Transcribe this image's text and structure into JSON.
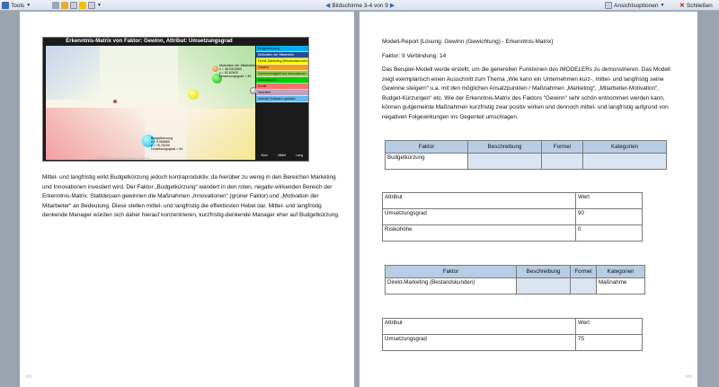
{
  "toolbar": {
    "tools_label": "Tools",
    "page_info": "Bildschirme 3-4 von 9",
    "view_options_label": "Ansichtsoptionen",
    "close_label": "Schließen"
  },
  "colors": {
    "page_background": "#9ba3ae",
    "table_header": "#b8cce4",
    "table_shade": "#dbe5f1"
  },
  "matrix": {
    "title": "Erkenntnis-Matrix von Faktor: Gewinn, Attribut: Umsetzungsgrad",
    "legend": [
      {
        "label": "Budgetkürzung",
        "color": "#00b0f0"
      },
      {
        "label": "Motivation der Mitarbeiter",
        "color": "#1f4e9c"
      },
      {
        "label": "Direkt-Marketing (Bestandskunden)",
        "color": "#ffff00"
      },
      {
        "label": "Gewinn",
        "color": "#f0a020"
      },
      {
        "label": "Geschwindigkeit bei Innovationen",
        "color": "#92d050"
      },
      {
        "label": "Innovationen",
        "color": "#00cc00"
      },
      {
        "label": "Kredit",
        "color": "#ff7070"
      },
      {
        "label": "Vertriebe",
        "color": "#c0a0c0"
      },
      {
        "label": "Vertrieb Software-updates",
        "color": "#60b8f0"
      }
    ],
    "legend_footer": [
      "Kurz",
      "Mittel",
      "Lang"
    ],
    "bubble_labels": {
      "motivation": [
        "Motivation der Mitarbeiter",
        "x = 48,9410063",
        "y = 82,62633",
        "Umsetzungsgrad = 40"
      ],
      "budget": [
        "Budgetkürzung",
        "x = 9,985865",
        "y = 76,76230",
        "Umsetzungsgrad = 90"
      ]
    },
    "axis_note": "Zeitraum der Auswirkung auf das Zielsystem"
  },
  "left_text": "Mittel- und langfristig wirkt Budgetkürzung jedoch kontraproduktiv, da hierüber zu wenig in den Bereichen Marketing und Innovationen investiert wird. Der Faktor „Budgetkürzung“ wandert in den roten, negativ-wirkenden Bereich der Erkenntnis-Matrix. Stattdessen gewinnen die Maßnahmen „Innovationen“ (grüner Faktor) und „Motivation der Mitarbeiter“ an Bedeutung. Diese stellen mittel- und langfristig die effektivsten Hebel dar. Mittel- und langfristig denkende Manager würden sich daher hierauf konzentrieren, kurzfristig-denkende Manager eher auf Budgetkürzung.",
  "report": {
    "title": "Modell-Report [Lösung: Gewinn (Gewichtung) - Erkenntnis-Matrix]",
    "stats": "Faktor: 9   Verbindung: 14",
    "intro": "Das Beispiel-Modell wurde erstellt, um die generellen Funktionen des iMODELERs zu demonstrieren.  Das Modell zeigt exemplarisch einen Ausschnitt zum Thema „Wie kann ein Unternehmen kurz-, mittel- und langfristig seine Gewinne steigern“ u.a. mit den möglichen Ansatzpunkten / Maßnahmen „Marketing“, „Mitarbeiter-Motivation“, Budget-Kürzungen“ etc.  Wie der Erkenntnis-Matrix des Faktors \"Gewinn\" sehr schön entnommen werden kann, können gutgemeinte Maßnahmen kurzfristig zwar positiv wirken und dennoch mittel- und langfristig aufgrund von negativen Folgewirkungen ins Gegenteil umschlagen."
  },
  "table1": {
    "headers": [
      "Faktor",
      "Beschreibung",
      "Formel",
      "Kategorien"
    ],
    "row": [
      "Budgetkürzung",
      "",
      "",
      ""
    ]
  },
  "attr1": {
    "headers": [
      "Attribut",
      "Wert"
    ],
    "rows": [
      [
        "Umsetzungsgrad",
        "90"
      ],
      [
        "Risikohöhe",
        "0"
      ]
    ]
  },
  "table2": {
    "headers": [
      "Faktor",
      "Beschreibung",
      "Formel",
      "Kategorien"
    ],
    "row": [
      "Direkt-Marketing (Bestandskunden)",
      "",
      "",
      "Maßnahme"
    ]
  },
  "attr2": {
    "headers": [
      "Attribut",
      "Wert"
    ],
    "rows": [
      [
        "Umsetzungsgrad",
        "75"
      ]
    ]
  }
}
